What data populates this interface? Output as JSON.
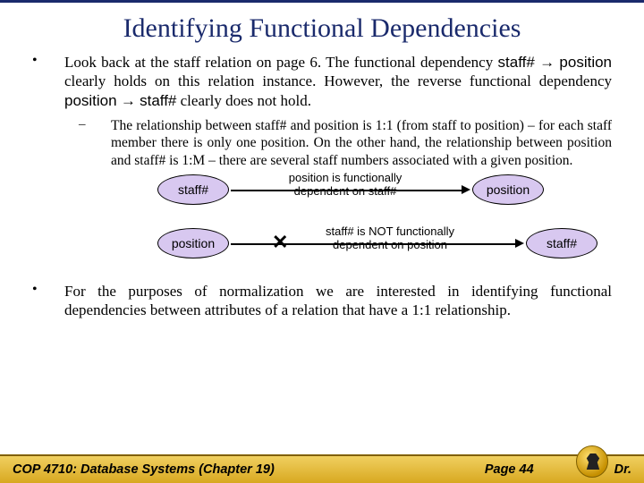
{
  "title": "Identifying Functional Dependencies",
  "bullet1": {
    "prefix": "Look back at the staff relation on page 6.  The functional dependency ",
    "fd1_left": "staff#",
    "arrow": " → ",
    "fd1_right": "position",
    "mid1": " clearly holds on this relation instance. However, the reverse functional dependency ",
    "fd2_left": "position",
    "fd2_right": "staff#",
    "suffix": " clearly does not hold."
  },
  "sub1": "The relationship between staff# and position is 1:1 (from staff to position) – for each staff member there is only one position.  On the other hand, the relationship between position and staff# is 1:M – there are several staff numbers associated with a given position.",
  "diagram1": {
    "left": "staff#",
    "caption_top": "position is functionally",
    "caption_bot": "dependent on staff#",
    "right": "position"
  },
  "diagram2": {
    "left": "position",
    "caption_top": "staff# is NOT functionally",
    "caption_bot": "dependent on position",
    "right": "staff#"
  },
  "bullet2": "For the purposes of normalization we are interested in identifying functional dependencies between attributes of a relation that have a 1:1 relationship.",
  "footer": {
    "left": "COP 4710: Database Systems  (Chapter 19)",
    "mid": "Page 44",
    "right": "Dr."
  }
}
